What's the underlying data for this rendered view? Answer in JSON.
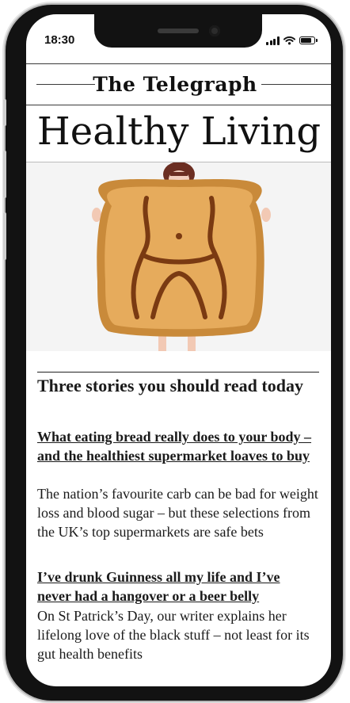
{
  "status_bar": {
    "time": "18:30",
    "battery_level": 0.85
  },
  "masthead": {
    "brand": "The Telegraph"
  },
  "section": {
    "title": "Healthy Living"
  },
  "hero": {
    "alt": "woman-holding-toast"
  },
  "stories_block": {
    "heading": "Three stories you should read today",
    "stories": [
      {
        "title": "What eating bread really does to your body – and the healthiest supermarket loaves to buy",
        "summary": "The nation’s favourite carb can be bad for weight loss and blood sugar – but these selections from the UK’s top supermarkets are safe bets"
      },
      {
        "title": "I’ve drunk Guinness all my life and I’ve never had a hangover or a beer belly",
        "summary": "On St Patrick’s Day, our writer explains her lifelong love of the black stuff – not least for its gut health benefits"
      }
    ]
  },
  "colors": {
    "toast_crust": "#c98a3a",
    "toast_face": "#e6ab5c",
    "text": "#1a1a1a"
  }
}
